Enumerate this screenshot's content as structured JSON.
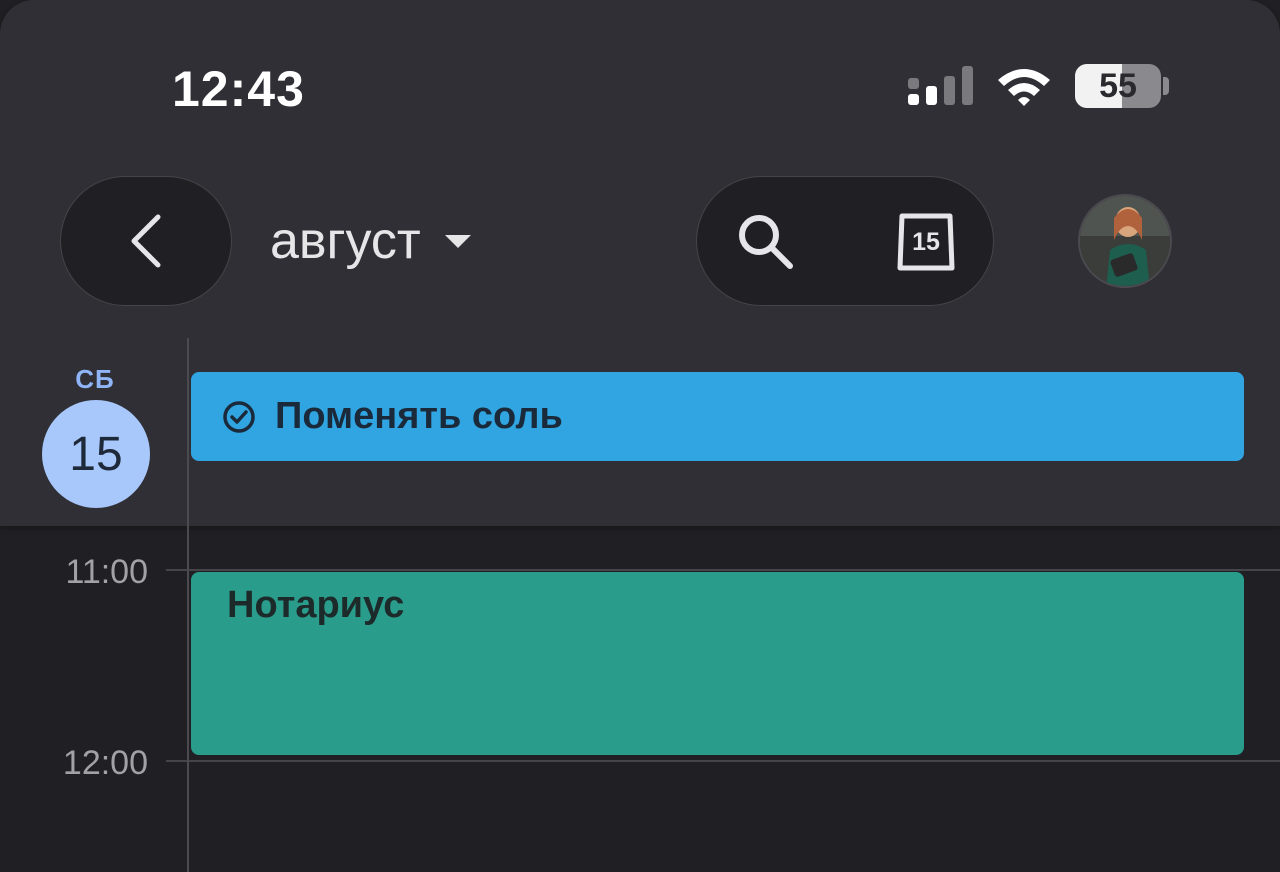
{
  "status_bar": {
    "time": "12:43",
    "battery_level": "55",
    "battery_fraction": 0.55,
    "icons": [
      "signal-icon",
      "wifi-icon",
      "battery-icon"
    ]
  },
  "header": {
    "month": "август",
    "today_date": "15",
    "icons": [
      "back-arrow-icon",
      "caret-down-icon",
      "search-icon",
      "calendar-today-icon"
    ]
  },
  "day": {
    "weekday": "СБ",
    "date": "15"
  },
  "all_day_tasks": [
    {
      "title": "Поменять соль",
      "color": "#30a5e2",
      "icon": "check-circle-icon"
    }
  ],
  "timeline": {
    "hours": [
      "11:00",
      "12:00"
    ]
  },
  "events": [
    {
      "title": "Нотариус",
      "color": "#2a9c8c"
    }
  ]
}
